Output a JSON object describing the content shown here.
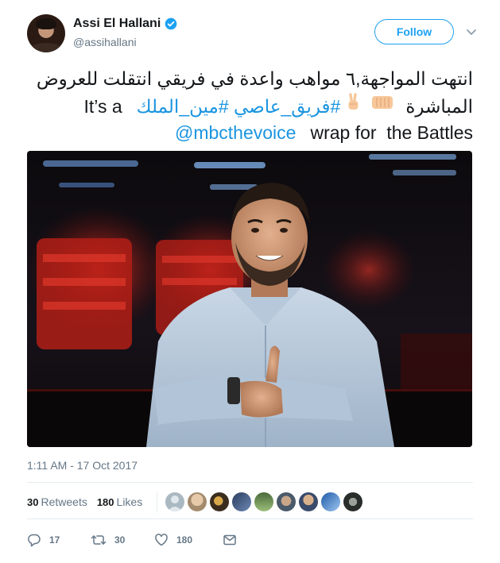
{
  "author": {
    "display_name": "Assi El Hallani",
    "handle": "@assihallani",
    "verified": true,
    "avatar_icon": "avatar-photo"
  },
  "follow_label": "Follow",
  "more_icon": "chevron-down-icon",
  "tweet": {
    "line1": "انتهت المواجهة,٦ مواهب واعدة  في فريقي انتقلت للعروض",
    "line2_text": "It’s a",
    "line2_hashtags": "#فريق_عاصي #مين_الملك",
    "line2_emojis": [
      "victory-hand-icon",
      "fist-bump-icon"
    ],
    "line2_arabic": "المباشرة",
    "line3_mention": "@mbcthevoice",
    "line3_text": "wrap for  the Battles"
  },
  "timestamp": "1:11 AM - 17 Oct 2017",
  "stats": {
    "retweets_count": "30",
    "retweets_label": "Retweets",
    "likes_count": "180",
    "likes_label": "Likes",
    "likers": [
      "liker-avatar",
      "liker-avatar",
      "liker-avatar",
      "liker-avatar",
      "liker-avatar",
      "liker-avatar",
      "liker-avatar",
      "liker-avatar",
      "liker-avatar"
    ]
  },
  "actions": {
    "reply_count": "17",
    "retweet_count": "30",
    "like_count": "180"
  },
  "colors": {
    "link": "#1b95e0",
    "accent": "#1da1f2",
    "secondary_text": "#657786",
    "primary_text": "#14171a",
    "divider": "#e6ecf0"
  }
}
